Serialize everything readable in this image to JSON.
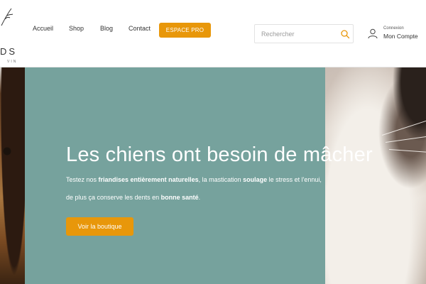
{
  "brand": {
    "logo_letters": "DS",
    "logo_sub": "VIN"
  },
  "nav": {
    "items": [
      {
        "label": "Accueil"
      },
      {
        "label": "Shop"
      },
      {
        "label": "Blog"
      },
      {
        "label": "Contact"
      }
    ],
    "pro_button": "ESPACE PRO"
  },
  "search": {
    "placeholder": "Rechercher",
    "icon": "search-icon"
  },
  "account": {
    "icon": "user-icon",
    "small_label": "Connexion",
    "label": "Mon Compte"
  },
  "hero": {
    "title": "Les chiens ont besoin de mâcher",
    "line1": {
      "p1": "Testez nos ",
      "b1": "friandises entièrement naturelles",
      "p2": ", la mastication ",
      "b2": "soulage",
      "p3": " le stress et l'ennui,"
    },
    "line2": {
      "p1": "de plus ça conserve les dents en ",
      "b1": "bonne santé",
      "p2": "."
    },
    "cta": "Voir la boutique"
  },
  "colors": {
    "accent": "#e8970a",
    "hero_bg": "#76a29d"
  }
}
